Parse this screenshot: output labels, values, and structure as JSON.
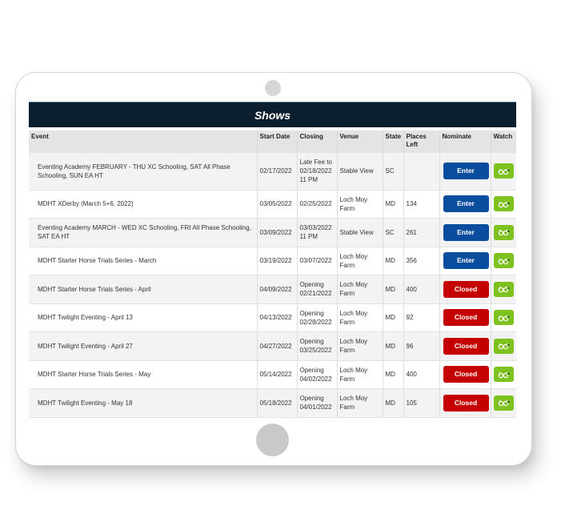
{
  "title": "Shows",
  "columns": {
    "event": "Event",
    "start_date": "Start Date",
    "closing": "Closing",
    "venue": "Venue",
    "state": "State",
    "places_left": "Places Left",
    "nominate": "Nominate",
    "watch": "Watch"
  },
  "colors": {
    "header_bg": "#0c1f2e",
    "enter": "#0a4c9e",
    "closed": "#c40000",
    "watch": "#7ec220"
  },
  "watch_icon": "glasses-plus-icon",
  "rows": [
    {
      "event": "Eventing Academy FEBRUARY - THU XC Schooling, SAT All Phase Schooling, SUN EA HT",
      "start_date": "02/17/2022",
      "closing": "Late Fee to 02/18/2022 11 PM",
      "venue": "Stable View",
      "state": "SC",
      "places_left": "",
      "nominate": "Enter",
      "status": "open"
    },
    {
      "event": "MDHT XDerby (March 5+6, 2022)",
      "start_date": "03/05/2022",
      "closing": "02/25/2022",
      "venue": "Loch Moy Farm",
      "state": "MD",
      "places_left": "134",
      "nominate": "Enter",
      "status": "open"
    },
    {
      "event": "Eventing Academy MARCH - WED XC Schooling, FRI All Phase Schooling, SAT EA HT",
      "start_date": "03/09/2022",
      "closing": "03/03/2022 11 PM",
      "venue": "Stable View",
      "state": "SC",
      "places_left": "261",
      "nominate": "Enter",
      "status": "open"
    },
    {
      "event": "MDHT Starter Horse Trials Series - March",
      "start_date": "03/19/2022",
      "closing": "03/07/2022",
      "venue": "Loch Moy Farm",
      "state": "MD",
      "places_left": "356",
      "nominate": "Enter",
      "status": "open"
    },
    {
      "event": "MDHT Starter Horse Trials Series - April",
      "start_date": "04/09/2022",
      "closing": "Opening 02/21/2022",
      "venue": "Loch Moy Farm",
      "state": "MD",
      "places_left": "400",
      "nominate": "Closed",
      "status": "closed"
    },
    {
      "event": "MDHT Twilight Eventing - April 13",
      "start_date": "04/13/2022",
      "closing": "Opening 02/28/2022",
      "venue": "Loch Moy Farm",
      "state": "MD",
      "places_left": "92",
      "nominate": "Closed",
      "status": "closed"
    },
    {
      "event": "MDHT Twilight Eventing - April 27",
      "start_date": "04/27/2022",
      "closing": "Opening 03/25/2022",
      "venue": "Loch Moy Farm",
      "state": "MD",
      "places_left": "96",
      "nominate": "Closed",
      "status": "closed"
    },
    {
      "event": "MDHT Starter Horse Trials Series - May",
      "start_date": "05/14/2022",
      "closing": "Opening 04/02/2022",
      "venue": "Loch Moy Farm",
      "state": "MD",
      "places_left": "400",
      "nominate": "Closed",
      "status": "closed"
    },
    {
      "event": "MDHT Twilight Eventing - May 18",
      "start_date": "05/18/2022",
      "closing": "Opening 04/01/2022",
      "venue": "Loch Moy Farm",
      "state": "MD",
      "places_left": "105",
      "nominate": "Closed",
      "status": "closed"
    }
  ]
}
